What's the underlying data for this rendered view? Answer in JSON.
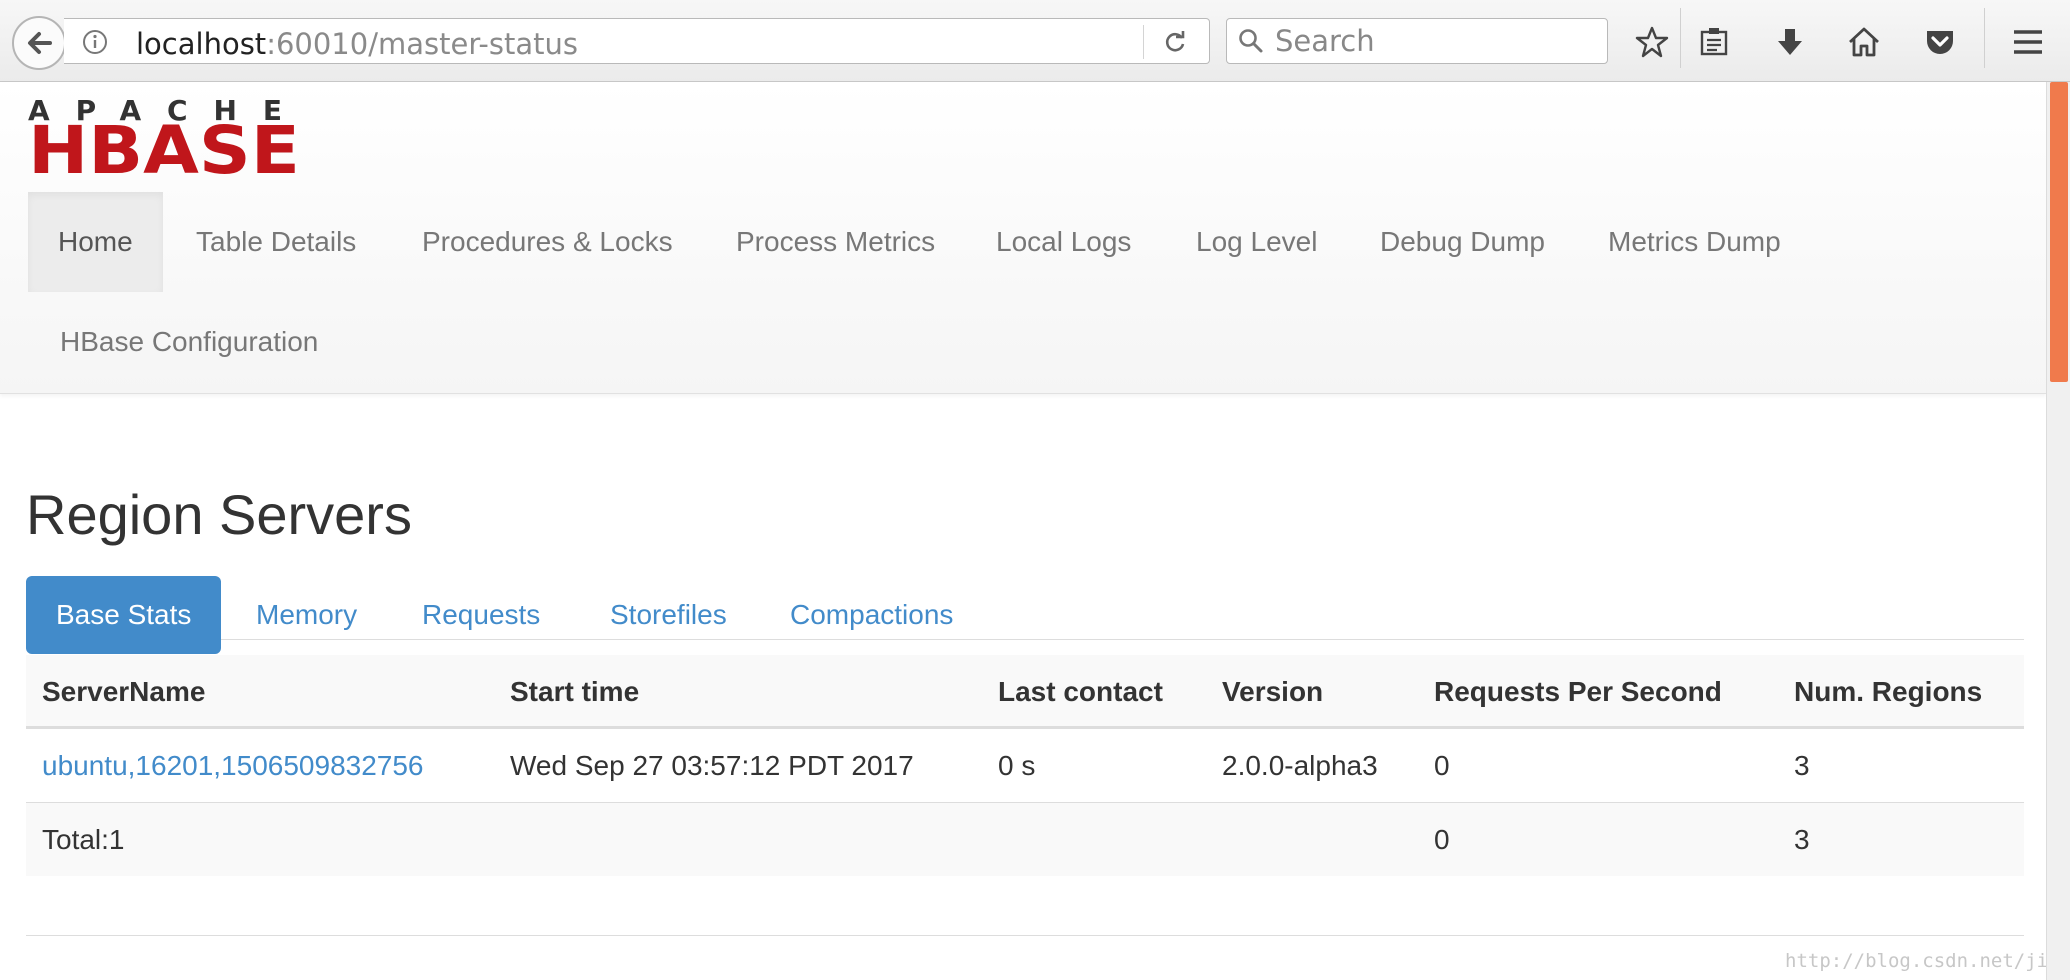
{
  "browser": {
    "url_host": "localhost",
    "url_path": ":60010/master-status",
    "search_placeholder": "Search"
  },
  "logo": {
    "top_text": "APACHE",
    "main_text": "HBASE",
    "colors": {
      "top": "#333333",
      "main": "#c0161b"
    }
  },
  "nav": {
    "items": [
      {
        "label": "Home",
        "active": true
      },
      {
        "label": "Table Details"
      },
      {
        "label": "Procedures & Locks"
      },
      {
        "label": "Process Metrics"
      },
      {
        "label": "Local Logs"
      },
      {
        "label": "Log Level"
      },
      {
        "label": "Debug Dump"
      },
      {
        "label": "Metrics Dump"
      },
      {
        "label": "HBase Configuration"
      }
    ]
  },
  "region_servers": {
    "title": "Region Servers",
    "tabs": [
      {
        "label": "Base Stats",
        "active": true
      },
      {
        "label": "Memory"
      },
      {
        "label": "Requests"
      },
      {
        "label": "Storefiles"
      },
      {
        "label": "Compactions"
      }
    ],
    "columns": [
      "ServerName",
      "Start time",
      "Last contact",
      "Version",
      "Requests Per Second",
      "Num. Regions"
    ],
    "rows": [
      {
        "server_name": "ubuntu,16201,1506509832756",
        "start_time": "Wed Sep 27 03:57:12 PDT 2017",
        "last_contact": "0 s",
        "version": "2.0.0-alpha3",
        "requests_per_second": "0",
        "num_regions": "3"
      }
    ],
    "total": {
      "label": "Total:1",
      "requests_per_second": "0",
      "num_regions": "3"
    }
  },
  "watermark": "http://blog.csdn.net/jiecxy",
  "colors": {
    "accent": "#428bca",
    "scroll_thumb": "#f07a4c"
  }
}
